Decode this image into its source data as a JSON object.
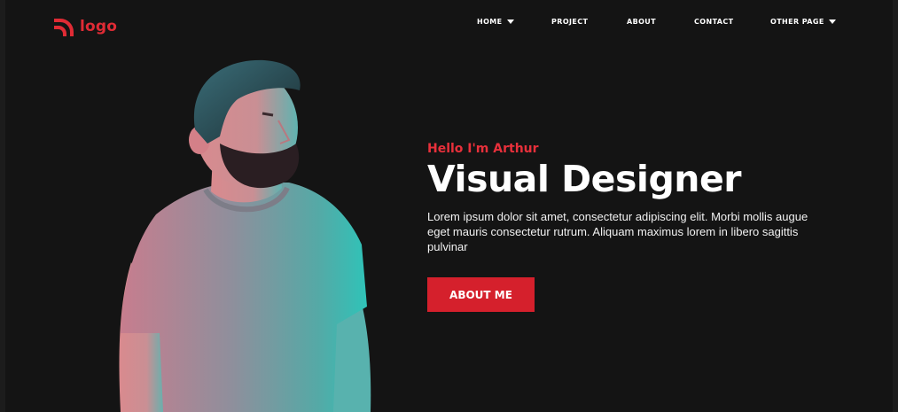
{
  "brand": {
    "name": "logo",
    "icon": "rss-icon",
    "color": "#e02b35"
  },
  "nav": {
    "items": [
      {
        "label": "HOME",
        "has_dropdown": true
      },
      {
        "label": "PROJECT",
        "has_dropdown": false
      },
      {
        "label": "ABOUT",
        "has_dropdown": false
      },
      {
        "label": "CONTACT",
        "has_dropdown": false
      },
      {
        "label": "OTHER PAGE",
        "has_dropdown": true
      }
    ]
  },
  "hero": {
    "greeting": "Hello I'm Arthur",
    "headline": "Visual Designer",
    "description": "Lorem ipsum dolor sit amet, consectetur adipiscing elit. Morbi mollis augue eget mauris consectetur rutrum. Aliquam maximus lorem in libero sagittis pulvinar",
    "cta_label": "ABOUT ME",
    "accent_color": "#d5202c"
  },
  "colors": {
    "background": "#141414",
    "text": "#ffffff"
  }
}
